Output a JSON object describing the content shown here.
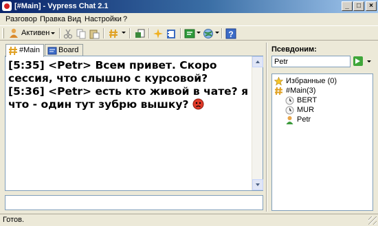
{
  "window": {
    "title": "[#Main] - Vypress Chat 2.1",
    "min_glyph": "_",
    "max_glyph": "□",
    "close_glyph": "×"
  },
  "menu": [
    "Разговор",
    "Правка",
    "Вид",
    "Настройки",
    "?"
  ],
  "toolbar": {
    "status_label": "Активен"
  },
  "tabs": [
    {
      "label": "#Main",
      "icon": "hash-icon",
      "active": true
    },
    {
      "label": "Board",
      "icon": "board-icon",
      "active": false
    }
  ],
  "chat": {
    "messages": [
      {
        "time": "[5:35]",
        "nick": "<Petr>",
        "text": "Всем привет. Скоро сессия, что слышно с курсовой?"
      },
      {
        "time": "[5:36]",
        "nick": "<Petr>",
        "text": "есть кто живой в чате? я что - один тут зубрю вышку?"
      }
    ]
  },
  "input": {
    "value": ""
  },
  "right_panel": {
    "title": "Псевдоним:",
    "nick_value": "Petr",
    "tree": [
      {
        "label": "Избранные (0)",
        "icon": "star-icon",
        "level": 0
      },
      {
        "label": "#Main(3)",
        "icon": "hash-icon",
        "level": 0
      },
      {
        "label": "BERT",
        "icon": "user-away-icon",
        "level": 1
      },
      {
        "label": "MUR",
        "icon": "user-away-icon",
        "level": 1
      },
      {
        "label": "Petr",
        "icon": "user-active-icon",
        "level": 1
      }
    ]
  },
  "statusbar": {
    "text": "Готов."
  }
}
